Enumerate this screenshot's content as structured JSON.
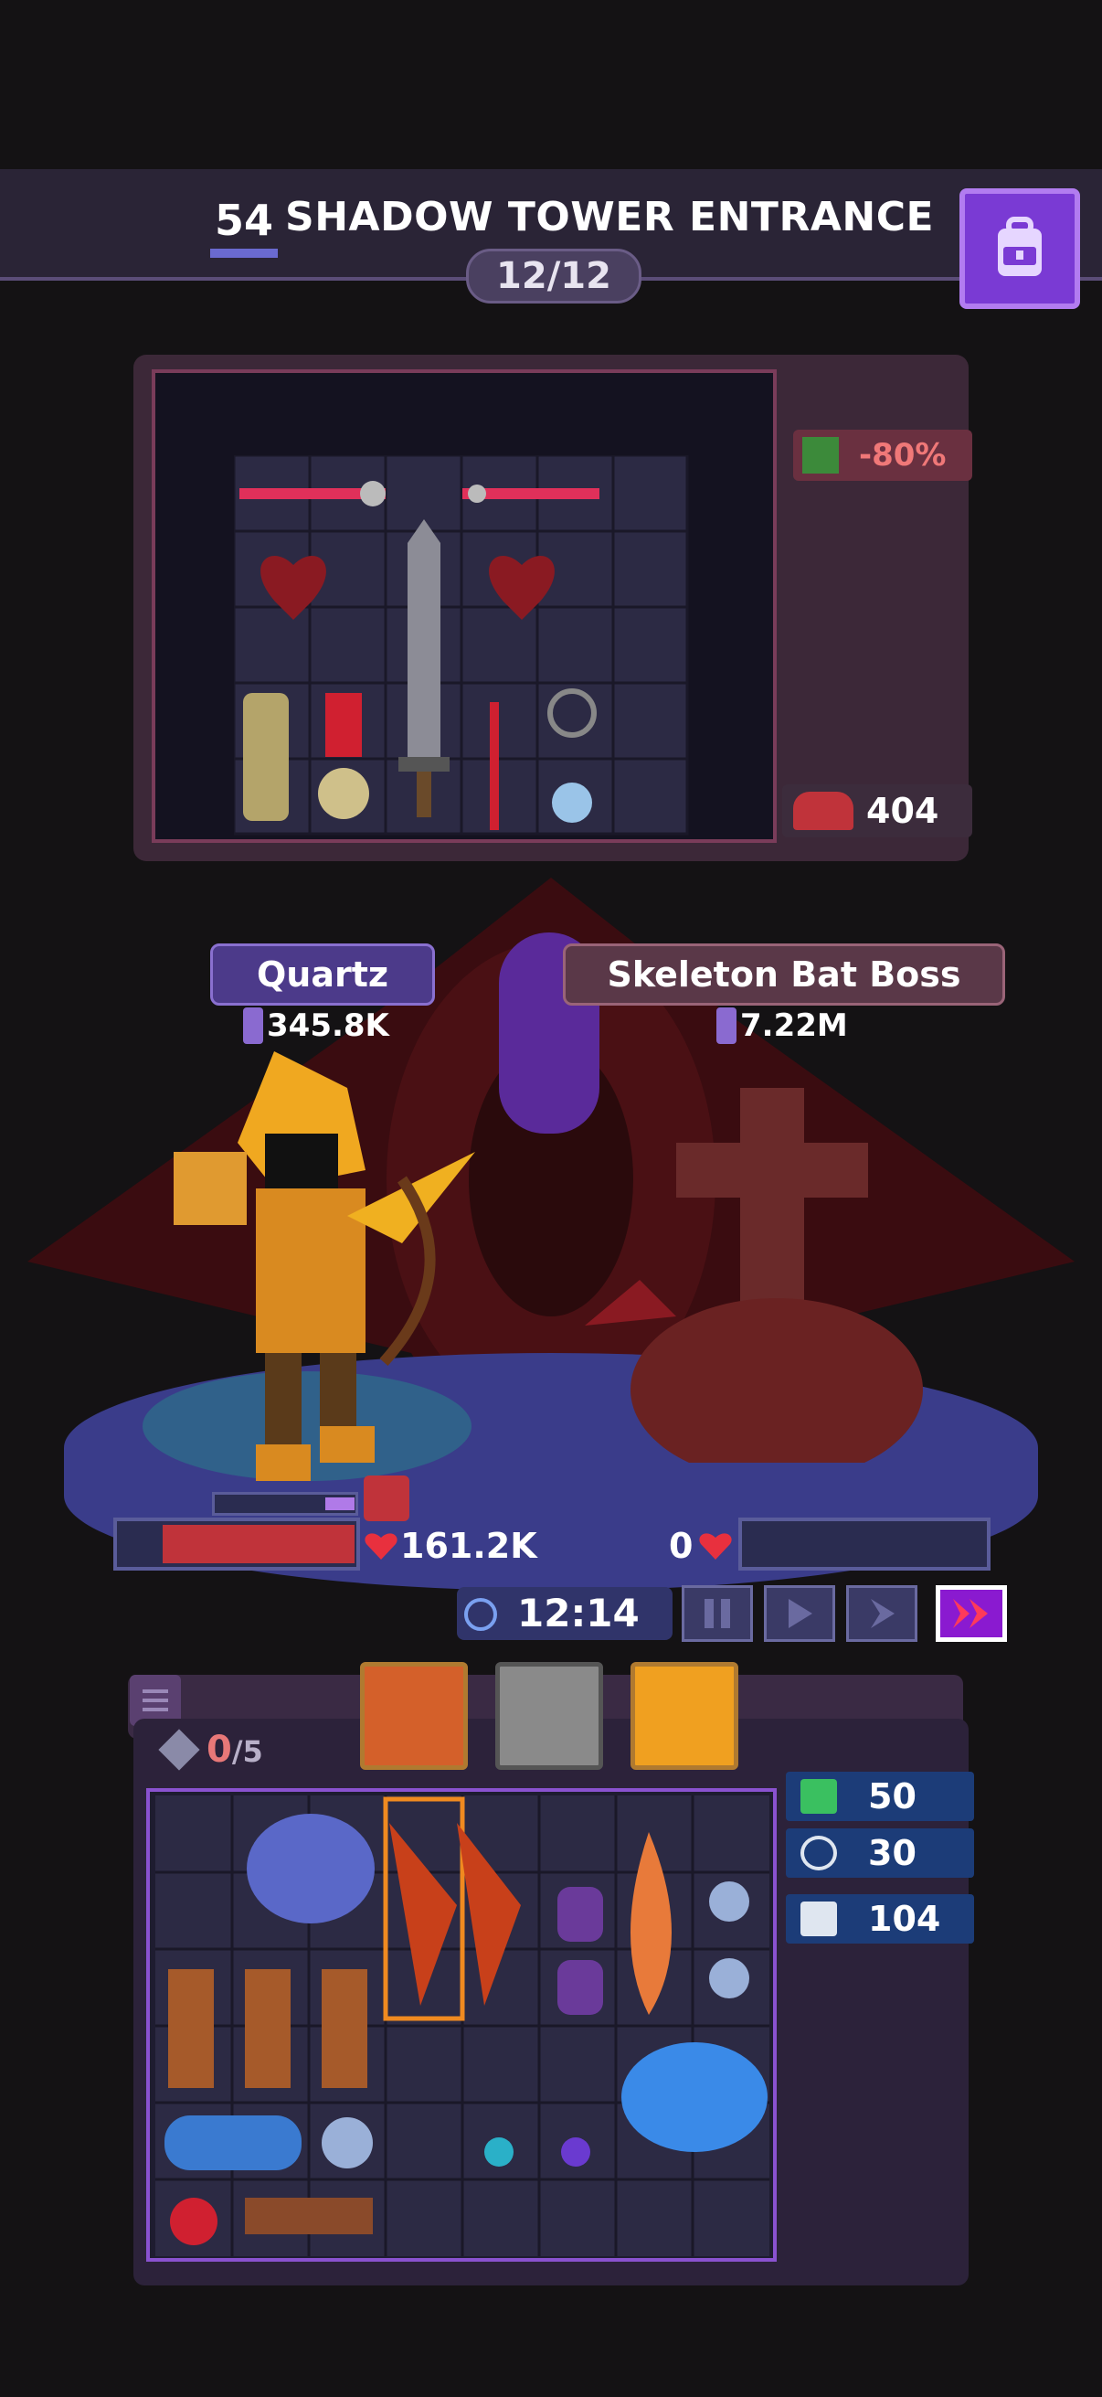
{
  "header": {
    "level": "54",
    "title": "SHADOW TOWER ENTRANCE",
    "wave": "12/12"
  },
  "enemy_board": {
    "modifier": "-80%",
    "hp": "404"
  },
  "battle": {
    "player_name": "Quartz",
    "player_power": "345.8K",
    "boss_name": "Skeleton Bat Boss",
    "boss_power": "7.22M",
    "player_hp": "161.2K",
    "enemy_hp": "0",
    "timer": "12:14"
  },
  "inventory": {
    "gems": "0",
    "gems_max": "/5",
    "stats": [
      "50",
      "30",
      "104"
    ]
  },
  "colors": {
    "accent": "#8a1ad0",
    "header_bg": "#2a2436",
    "hp_red": "#c0333a",
    "board_border": "#8a52d0"
  }
}
